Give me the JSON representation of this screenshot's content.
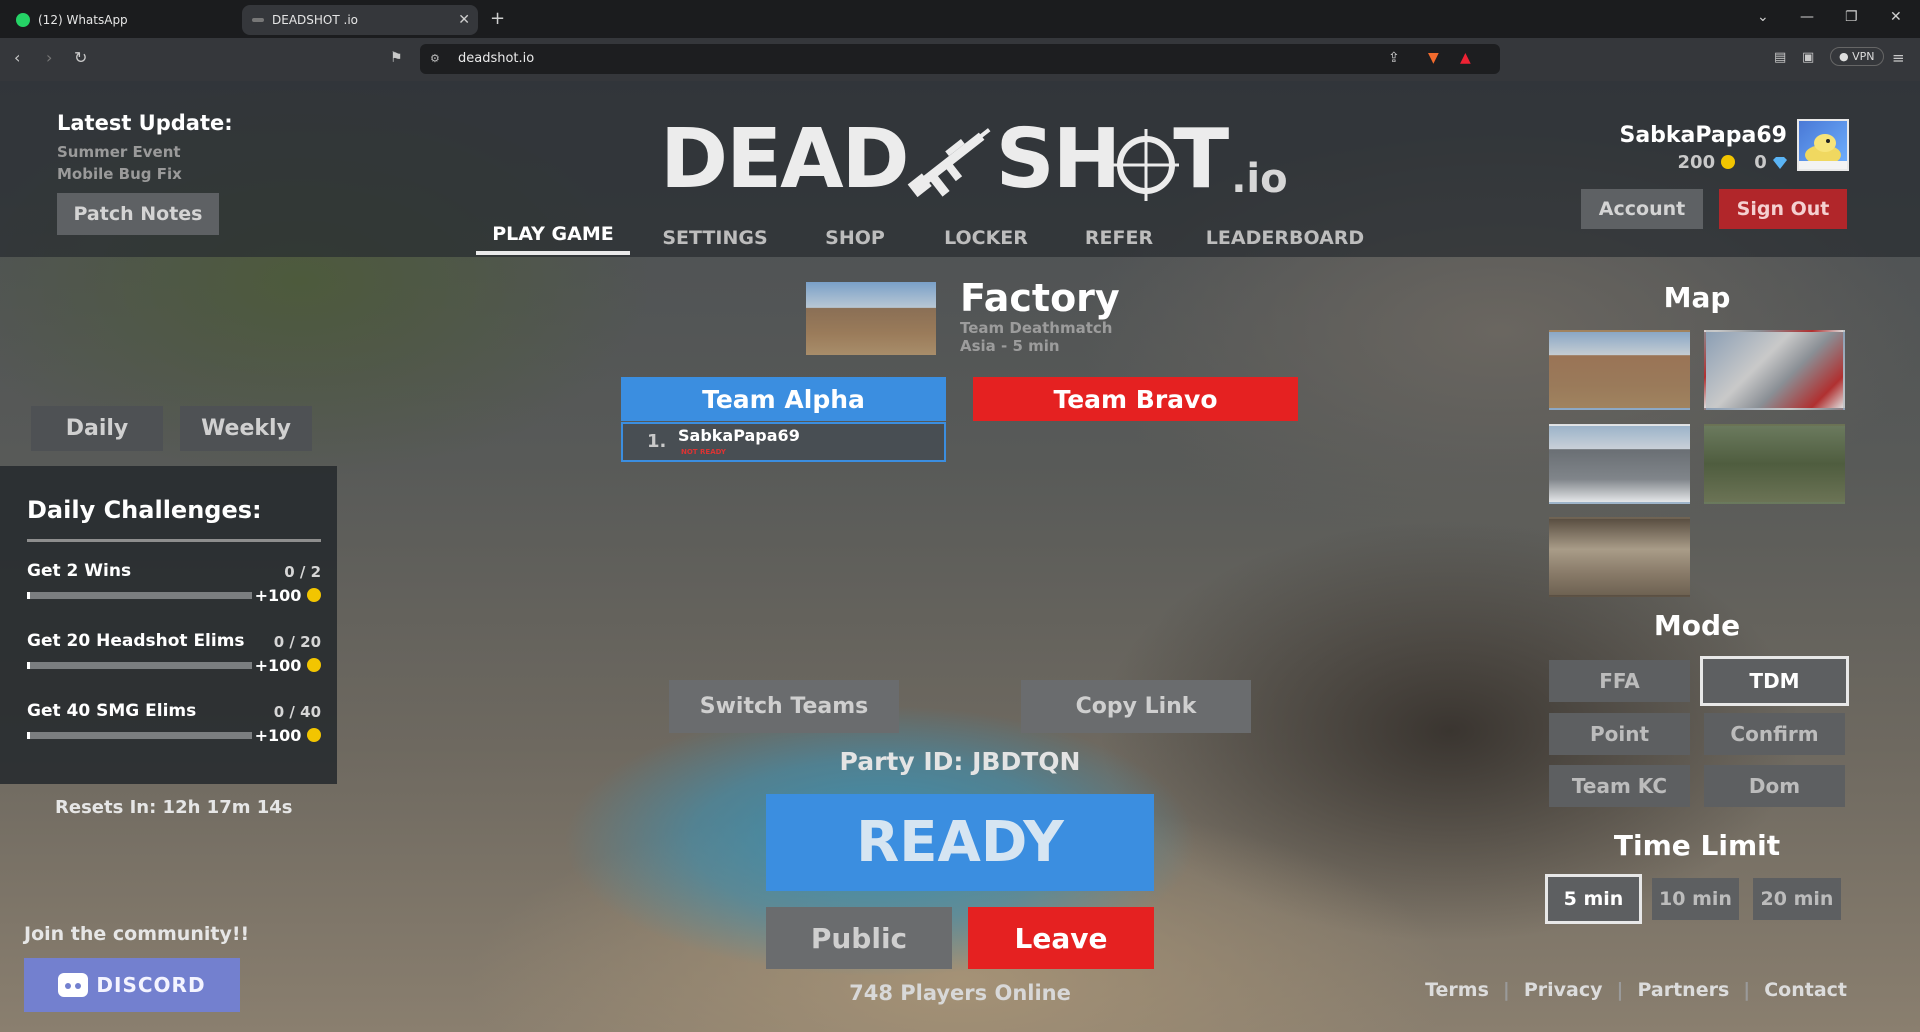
{
  "browser": {
    "tabs": [
      {
        "title": "(12) WhatsApp",
        "icon": "whatsapp-icon"
      },
      {
        "title": "DEADSHOT .io",
        "icon": "deadshot-icon"
      }
    ],
    "url": "deadshot.io",
    "vpn_label": "VPN"
  },
  "header": {
    "latest_update": {
      "title": "Latest Update:",
      "lines": [
        "Summer Event",
        "Mobile Bug Fix"
      ]
    },
    "patch_notes": "Patch Notes",
    "logo": {
      "left": "DEAD",
      "right": "SH",
      "end": "T",
      "suffix": ".io"
    },
    "nav": [
      "PLAY GAME",
      "SETTINGS",
      "SHOP",
      "LOCKER",
      "REFER",
      "LEADERBOARD"
    ],
    "user": {
      "name": "SabkaPapa69",
      "coins": "200",
      "gems": "0"
    },
    "account": "Account",
    "sign_out": "Sign Out"
  },
  "challenges": {
    "tabs": [
      "Daily",
      "Weekly"
    ],
    "title": "Daily Challenges:",
    "items": [
      {
        "name": "Get 2 Wins",
        "progress": "0 / 2",
        "reward": "+100",
        "fraction": 0
      },
      {
        "name": "Get 20 Headshot Elims",
        "progress": "0 / 20",
        "reward": "+100",
        "fraction": 0
      },
      {
        "name": "Get 40 SMG Elims",
        "progress": "0 / 40",
        "reward": "+100",
        "fraction": 0
      }
    ],
    "resets": "Resets In: 12h 17m 14s"
  },
  "community": {
    "label": "Join the community!!",
    "discord": "DISCORD"
  },
  "lobby": {
    "map_name": "Factory",
    "mode": "Team Deathmatch",
    "region": "Asia - 5 min",
    "team_alpha": "Team Alpha",
    "team_bravo": "Team Bravo",
    "player": {
      "index": "1.",
      "name": "SabkaPapa69",
      "status": "NOT READY"
    },
    "switch_teams": "Switch Teams",
    "copy_link": "Copy Link",
    "party_id": "Party ID: JBDTQN",
    "ready": "READY",
    "public": "Public",
    "leave": "Leave",
    "online": "748 Players Online"
  },
  "settings_panel": {
    "map_title": "Map",
    "mode_title": "Mode",
    "modes": [
      "FFA",
      "TDM",
      "Point",
      "Confirm",
      "Team KC",
      "Dom"
    ],
    "selected_mode": "TDM",
    "time_title": "Time Limit",
    "times": [
      "5 min",
      "10 min",
      "20 min"
    ],
    "selected_time": "5 min"
  },
  "footer": [
    "Terms",
    "Privacy",
    "Partners",
    "Contact"
  ],
  "colors": {
    "blue": "#3b8ee0",
    "red": "#e52121",
    "discord": "#7380cf",
    "coin": "#f2c500"
  }
}
